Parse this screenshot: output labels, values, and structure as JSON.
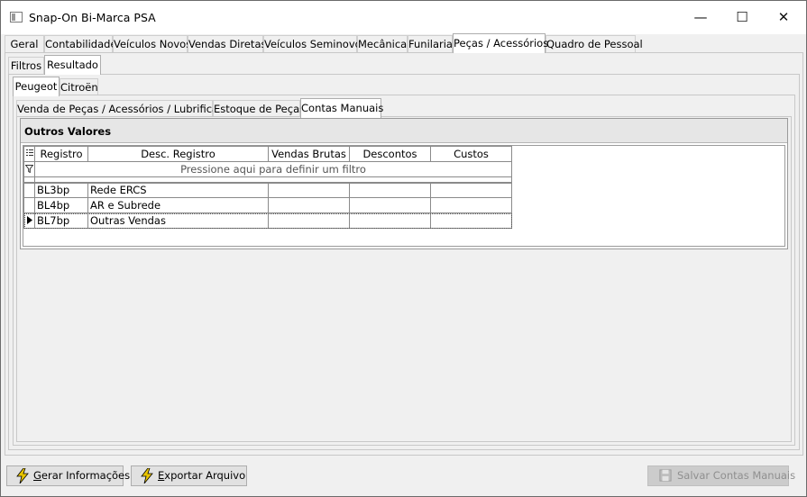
{
  "window": {
    "title": "Snap-On Bi-Marca PSA",
    "minimize_glyph": "—",
    "maximize_glyph": "☐",
    "close_glyph": "✕"
  },
  "main_tabs": [
    {
      "label": "Geral"
    },
    {
      "label": "Contabilidade"
    },
    {
      "label": "Veículos Novos"
    },
    {
      "label": "Vendas Diretas"
    },
    {
      "label": "Veículos Seminovos"
    },
    {
      "label": "Mecânica"
    },
    {
      "label": "Funilaria"
    },
    {
      "label": "Peças / Acessórios",
      "active": true
    },
    {
      "label": "Quadro de Pessoal"
    }
  ],
  "sub_tabs": [
    {
      "label": "Filtros"
    },
    {
      "label": "Resultado",
      "active": true
    }
  ],
  "brand_tabs": [
    {
      "label": "Peugeot",
      "active": true
    },
    {
      "label": "Citroën"
    }
  ],
  "section_tabs": [
    {
      "label": "Venda de Peças / Acessórios / Lubrificantes"
    },
    {
      "label": "Estoque de Peças"
    },
    {
      "label": "Contas Manuais",
      "active": true
    }
  ],
  "grid": {
    "caption": "Outros Valores",
    "columns": [
      "Registro",
      "Desc. Registro",
      "Vendas Brutas",
      "Descontos",
      "Custos"
    ],
    "filter_text": "Pressione aqui para definir um filtro",
    "rows": [
      {
        "registro": "BL3bp",
        "desc": "Rede ERCS",
        "vendas": "",
        "descontos": "",
        "custos": ""
      },
      {
        "registro": "BL4bp",
        "desc": "AR e Subrede",
        "vendas": "",
        "descontos": "",
        "custos": ""
      },
      {
        "registro": "BL7bp",
        "desc": "Outras Vendas",
        "vendas": "",
        "descontos": "",
        "custos": "",
        "current": true
      }
    ]
  },
  "buttons": {
    "gerar": {
      "pre": "",
      "key": "G",
      "post": "erar Informações"
    },
    "exportar": {
      "pre": "",
      "key": "E",
      "post": "xportar Arquivo"
    },
    "salvar": {
      "label": "Salvar Contas Manuais"
    }
  },
  "icons": {
    "lightning": "lightning-icon",
    "save": "floppy-disk-icon",
    "filter": "filter-icon",
    "row_indicator": "row-pointer-icon",
    "column_chooser": "column-chooser-icon"
  },
  "colors": {
    "accent_lightning": "#e8c400",
    "disabled_text": "#8f8f8f"
  }
}
